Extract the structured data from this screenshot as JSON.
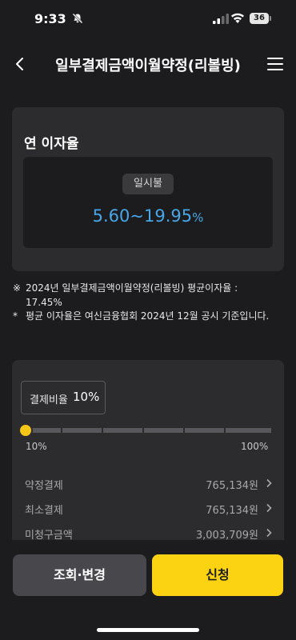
{
  "status": {
    "time": "9:33",
    "battery": "36"
  },
  "nav": {
    "title": "일부결제금액이월약정(리볼빙)"
  },
  "rate_card": {
    "title": "연 이자율",
    "badge": "일시불",
    "range": "5.60~19.95",
    "unit": "%"
  },
  "notice": {
    "line1_mark": "※",
    "line1": "2024년 일부결제금액이월약정(리볼빙) 평균이자율 : 17.45%",
    "line2_mark": "*",
    "line2": "평균 이자율은 여신금융협회 2024년 12월 공시 기준입니다."
  },
  "payment": {
    "ratio_label": "결제비율",
    "ratio_value": "10%",
    "slider_min": "10%",
    "slider_max": "100%",
    "slider_level": 0,
    "rows": [
      {
        "label": "약정결제",
        "value": "765,134원"
      },
      {
        "label": "최소결제",
        "value": "765,134원"
      },
      {
        "label": "미청구금액",
        "value": "3,003,709원"
      }
    ]
  },
  "buttons": {
    "secondary": "조회·변경",
    "primary": "신청"
  },
  "colors": {
    "accent": "#fcd312",
    "rate": "#47a7e8"
  }
}
